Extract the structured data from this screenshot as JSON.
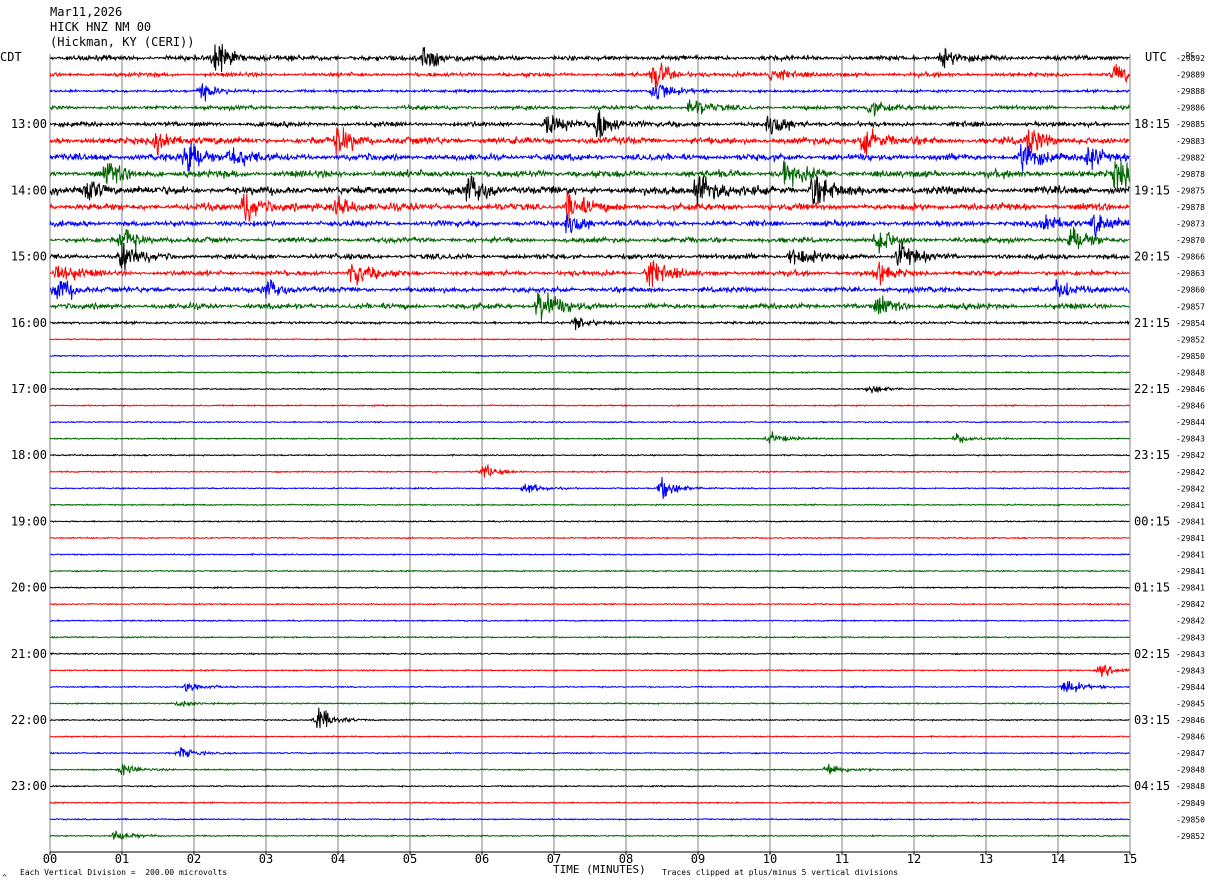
{
  "header": {
    "date": "Mar11,2026",
    "station": "HICK HNZ NM 00",
    "location": "(Hickman, KY (CERI))",
    "left_zone": "CDT",
    "right_zone": "UTC",
    "dc_label": "DC"
  },
  "footer": {
    "scale_note": "Each Vertical Division =  200.00 microvolts",
    "xlabel": "TIME (MINUTES)",
    "clip_note": "Traces clipped at plus/minus 5 vertical divisions",
    "corner_mark": "^"
  },
  "colors": {
    "trace_cycle": [
      "#000000",
      "#ff0000",
      "#0000ff",
      "#006400"
    ],
    "grid": "#808080",
    "baseline": "#000000"
  },
  "chart_data": {
    "type": "line",
    "subtype": "helicorder",
    "x_ticks": [
      "00",
      "01",
      "02",
      "03",
      "04",
      "05",
      "06",
      "07",
      "08",
      "09",
      "10",
      "11",
      "12",
      "13",
      "14",
      "15"
    ],
    "xlim": [
      0,
      15
    ],
    "xlabel": "TIME (MINUTES)",
    "left_hour_labels": [
      "13:00",
      "14:00",
      "15:00",
      "16:00",
      "17:00",
      "18:00",
      "19:00",
      "20:00",
      "21:00",
      "22:00",
      "23:00"
    ],
    "right_hour_labels": [
      "18:15",
      "19:15",
      "20:15",
      "21:15",
      "22:15",
      "23:15",
      "00:15",
      "01:15",
      "02:15",
      "03:15",
      "04:15"
    ],
    "hour_label_rows": [
      4,
      8,
      12,
      16,
      20,
      24,
      28,
      32,
      36,
      40,
      44
    ],
    "dc_offsets": [
      -29892,
      -29889,
      -29888,
      -29886,
      -29885,
      -29883,
      -29882,
      -29878,
      -29875,
      -29878,
      -29873,
      -29870,
      -29866,
      -29863,
      -29860,
      -29857,
      -29854,
      -29852,
      -29850,
      -29848,
      -29846,
      -29846,
      -29844,
      -29843,
      -29842,
      -29842,
      -29842,
      -29841,
      -29841,
      -29841,
      -29841,
      -29841,
      -29841,
      -29842,
      -29842,
      -29843,
      -29843,
      -29843,
      -29844,
      -29845,
      -29846,
      -29846,
      -29847,
      -29848,
      -29848,
      -29849,
      -29850,
      -29852
    ],
    "activity": [
      1.4,
      1.1,
      1.0,
      1.1,
      1.3,
      1.9,
      1.8,
      1.9,
      2.2,
      1.9,
      1.5,
      1.4,
      1.4,
      1.4,
      1.4,
      1.5,
      0.9,
      0.5,
      0.5,
      0.5,
      0.5,
      0.5,
      0.5,
      0.5,
      0.5,
      0.5,
      0.5,
      0.5,
      0.5,
      0.5,
      0.5,
      0.5,
      0.5,
      0.5,
      0.5,
      0.5,
      0.5,
      0.5,
      0.5,
      0.5,
      0.5,
      0.5,
      0.5,
      0.5,
      0.5,
      0.5,
      0.5,
      0.5
    ],
    "events": [
      {
        "row": 0,
        "minute": 2.3,
        "amp": 14
      },
      {
        "row": 0,
        "minute": 5.2,
        "amp": 12
      },
      {
        "row": 0,
        "minute": 12.4,
        "amp": 7
      },
      {
        "row": 1,
        "minute": 8.4,
        "amp": 12
      },
      {
        "row": 1,
        "minute": 10.0,
        "amp": 8
      },
      {
        "row": 1,
        "minute": 14.8,
        "amp": 9
      },
      {
        "row": 2,
        "minute": 8.4,
        "amp": 12
      },
      {
        "row": 2,
        "minute": 2.1,
        "amp": 7
      },
      {
        "row": 3,
        "minute": 8.9,
        "amp": 9
      },
      {
        "row": 3,
        "minute": 11.4,
        "amp": 7
      },
      {
        "row": 4,
        "minute": 7.6,
        "amp": 16
      },
      {
        "row": 4,
        "minute": 10.0,
        "amp": 12
      },
      {
        "row": 4,
        "minute": 6.9,
        "amp": 10
      },
      {
        "row": 5,
        "minute": 1.5,
        "amp": 12
      },
      {
        "row": 5,
        "minute": 4.0,
        "amp": 14
      },
      {
        "row": 5,
        "minute": 11.3,
        "amp": 12
      },
      {
        "row": 5,
        "minute": 13.6,
        "amp": 12
      },
      {
        "row": 6,
        "minute": 1.9,
        "amp": 18
      },
      {
        "row": 6,
        "minute": 2.5,
        "amp": 12
      },
      {
        "row": 6,
        "minute": 13.5,
        "amp": 14
      },
      {
        "row": 6,
        "minute": 14.4,
        "amp": 12
      },
      {
        "row": 7,
        "minute": 14.8,
        "amp": 16
      },
      {
        "row": 7,
        "minute": 0.8,
        "amp": 10
      },
      {
        "row": 7,
        "minute": 10.2,
        "amp": 12
      },
      {
        "row": 8,
        "minute": 9.0,
        "amp": 18
      },
      {
        "row": 8,
        "minute": 10.6,
        "amp": 16
      },
      {
        "row": 8,
        "minute": 5.8,
        "amp": 14
      },
      {
        "row": 8,
        "minute": 0.5,
        "amp": 12
      },
      {
        "row": 9,
        "minute": 2.7,
        "amp": 16
      },
      {
        "row": 9,
        "minute": 7.2,
        "amp": 14
      },
      {
        "row": 9,
        "minute": 4.0,
        "amp": 12
      },
      {
        "row": 10,
        "minute": 7.2,
        "amp": 12
      },
      {
        "row": 10,
        "minute": 14.5,
        "amp": 12
      },
      {
        "row": 10,
        "minute": 13.8,
        "amp": 10
      },
      {
        "row": 11,
        "minute": 1.0,
        "amp": 12
      },
      {
        "row": 11,
        "minute": 11.5,
        "amp": 12
      },
      {
        "row": 11,
        "minute": 14.2,
        "amp": 12
      },
      {
        "row": 12,
        "minute": 1.0,
        "amp": 14
      },
      {
        "row": 12,
        "minute": 10.3,
        "amp": 12
      },
      {
        "row": 12,
        "minute": 11.8,
        "amp": 12
      },
      {
        "row": 13,
        "minute": 4.2,
        "amp": 12
      },
      {
        "row": 13,
        "minute": 8.3,
        "amp": 14
      },
      {
        "row": 13,
        "minute": 11.5,
        "amp": 10
      },
      {
        "row": 13,
        "minute": 0.1,
        "amp": 10
      },
      {
        "row": 14,
        "minute": 0.1,
        "amp": 12
      },
      {
        "row": 14,
        "minute": 3.0,
        "amp": 10
      },
      {
        "row": 14,
        "minute": 14.0,
        "amp": 10
      },
      {
        "row": 15,
        "minute": 6.8,
        "amp": 22
      },
      {
        "row": 15,
        "minute": 11.5,
        "amp": 8
      },
      {
        "row": 16,
        "minute": 7.3,
        "amp": 5
      },
      {
        "row": 20,
        "minute": 11.4,
        "amp": 4
      },
      {
        "row": 23,
        "minute": 10.0,
        "amp": 5
      },
      {
        "row": 23,
        "minute": 12.6,
        "amp": 4
      },
      {
        "row": 25,
        "minute": 6.0,
        "amp": 7
      },
      {
        "row": 26,
        "minute": 8.5,
        "amp": 9
      },
      {
        "row": 26,
        "minute": 6.6,
        "amp": 5
      },
      {
        "row": 37,
        "minute": 14.6,
        "amp": 5
      },
      {
        "row": 38,
        "minute": 14.1,
        "amp": 8
      },
      {
        "row": 38,
        "minute": 1.9,
        "amp": 5
      },
      {
        "row": 39,
        "minute": 1.8,
        "amp": 3
      },
      {
        "row": 40,
        "minute": 3.7,
        "amp": 12
      },
      {
        "row": 42,
        "minute": 1.8,
        "amp": 5
      },
      {
        "row": 43,
        "minute": 10.8,
        "amp": 6
      },
      {
        "row": 43,
        "minute": 1.0,
        "amp": 5
      },
      {
        "row": 47,
        "minute": 0.9,
        "amp": 5
      }
    ]
  }
}
